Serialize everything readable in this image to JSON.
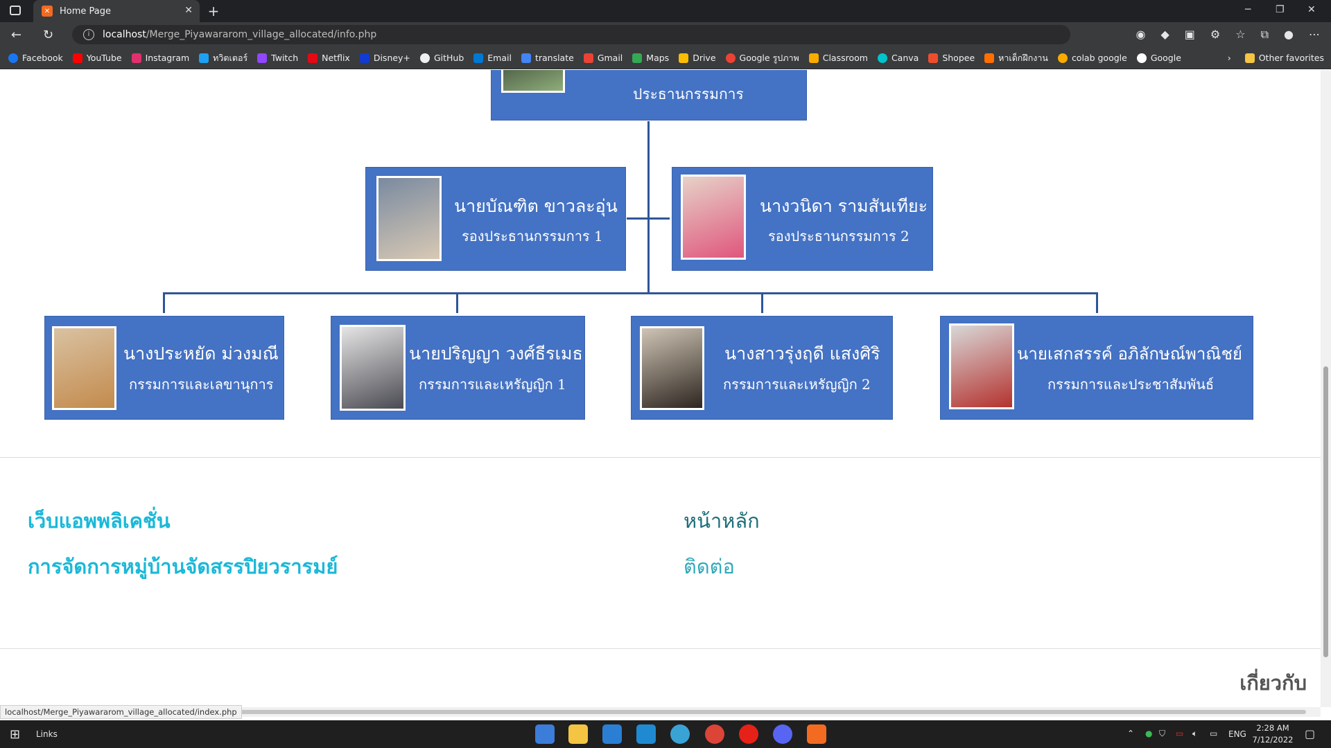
{
  "browser": {
    "tab_title": "Home Page",
    "new_tab": "+",
    "url_host": "localhost",
    "url_path": "/Merge_Piyawararom_village_allocated/info.php",
    "bookmarks": [
      "Facebook",
      "YouTube",
      "Instagram",
      "ทวิตเตอร์",
      "Twitch",
      "Netflix",
      "Disney+",
      "GitHub",
      "Email",
      "translate",
      "Gmail",
      "Maps",
      "Drive",
      "Google รูปภาพ",
      "Classroom",
      "Canva",
      "Shopee",
      "หาเด็กฝึกงาน",
      "colab google",
      "Google"
    ],
    "other_favorites": "Other favorites",
    "status_url": "localhost/Merge_Piyawararom_village_allocated/index.php"
  },
  "org": {
    "president": {
      "role": "ประธานกรรมการ"
    },
    "vice": [
      {
        "name": "นายบัณฑิต  ขาวละอุ่น",
        "role": "รองประธานกรรมการ 1"
      },
      {
        "name": "นางวนิดา รามสันเทียะ",
        "role": "รองประธานกรรมการ 2"
      }
    ],
    "members": [
      {
        "name": "นางประหยัด  ม่วงมณี",
        "role": "กรรมการและเลขานุการ"
      },
      {
        "name": "นายปริญญา  วงศ์ธีรเมธ",
        "role": "กรรมการและเหรัญญิก 1"
      },
      {
        "name": "นางสาวรุ่งฤดี  แสงศิริ",
        "role": "กรรมการและเหรัญญิก 2"
      },
      {
        "name": "นายเสกสรรค์  อภิลักษณ์พาณิชย์",
        "role": "กรรมการและประชาสัมพันธ์"
      }
    ]
  },
  "footer": {
    "brand_line1": "เว็บแอพพลิเคชั่น",
    "brand_line2": "การจัดการหมู่บ้านจัดสรรปิยวรารมย์",
    "link_home": "หน้าหลัก",
    "link_contact": "ติดต่อ",
    "about": "เกี่ยวกับ"
  },
  "taskbar": {
    "search_label": "Links",
    "lang": "ENG",
    "time": "2:28 AM",
    "date": "7/12/2022"
  }
}
